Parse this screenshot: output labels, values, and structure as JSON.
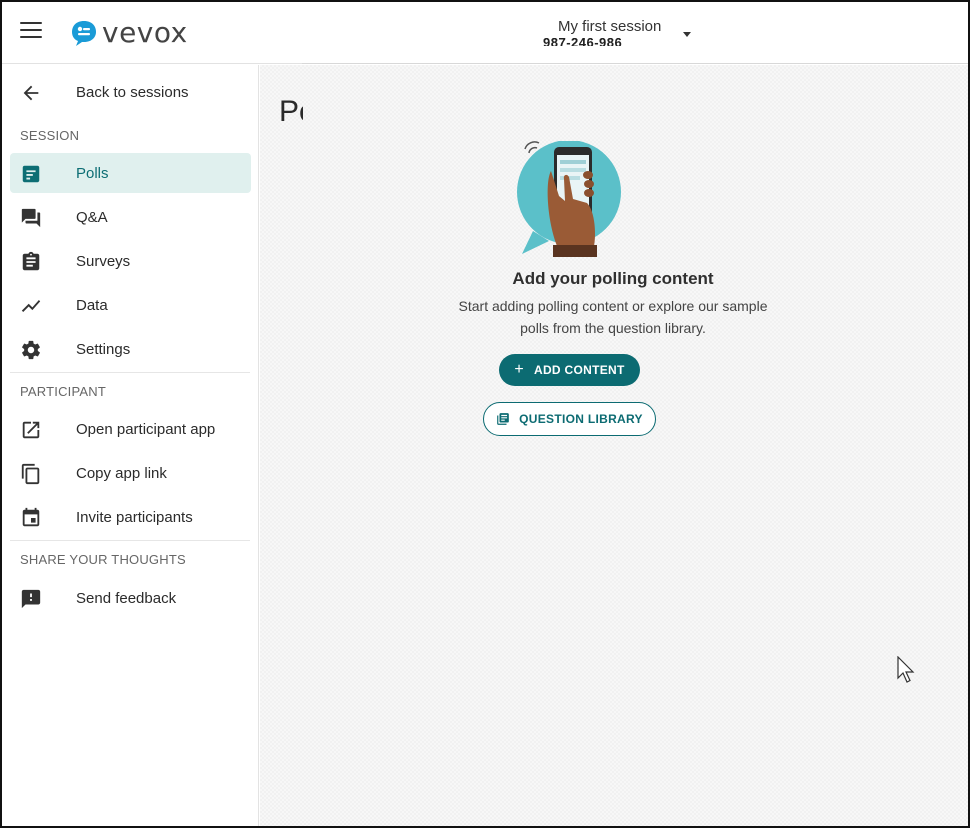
{
  "app": {
    "logo_text": "vevox"
  },
  "header": {
    "session_title": "My first session",
    "session_id": "987-246-986"
  },
  "sidebar": {
    "back_label": "Back to sessions",
    "session_section": "SESSION",
    "items": [
      {
        "label": "Polls",
        "icon": "polls-icon",
        "active": true
      },
      {
        "label": "Q&A",
        "icon": "qa-icon"
      },
      {
        "label": "Surveys",
        "icon": "clipboard-icon"
      },
      {
        "label": "Data",
        "icon": "trend-icon"
      },
      {
        "label": "Settings",
        "icon": "gear-icon"
      }
    ],
    "participant_section": "PARTICIPANT",
    "participant_items": [
      {
        "label": "Open participant app",
        "icon": "external-link-icon"
      },
      {
        "label": "Copy app link",
        "icon": "copy-icon"
      },
      {
        "label": "Invite participants",
        "icon": "calendar-icon"
      }
    ],
    "feedback_section": "SHARE YOUR THOUGHTS",
    "feedback_items": [
      {
        "label": "Send feedback",
        "icon": "feedback-icon"
      }
    ]
  },
  "main": {
    "page_title": "Polls",
    "empty_title": "Add your polling content",
    "empty_description": "Start adding polling content or explore our sample polls from the question library.",
    "add_button": "ADD CONTENT",
    "library_button": "QUESTION LIBRARY"
  },
  "colors": {
    "accent": "#0c6b72",
    "active_bg": "#e0f0ee",
    "logo_blue": "#1a9bd7"
  }
}
